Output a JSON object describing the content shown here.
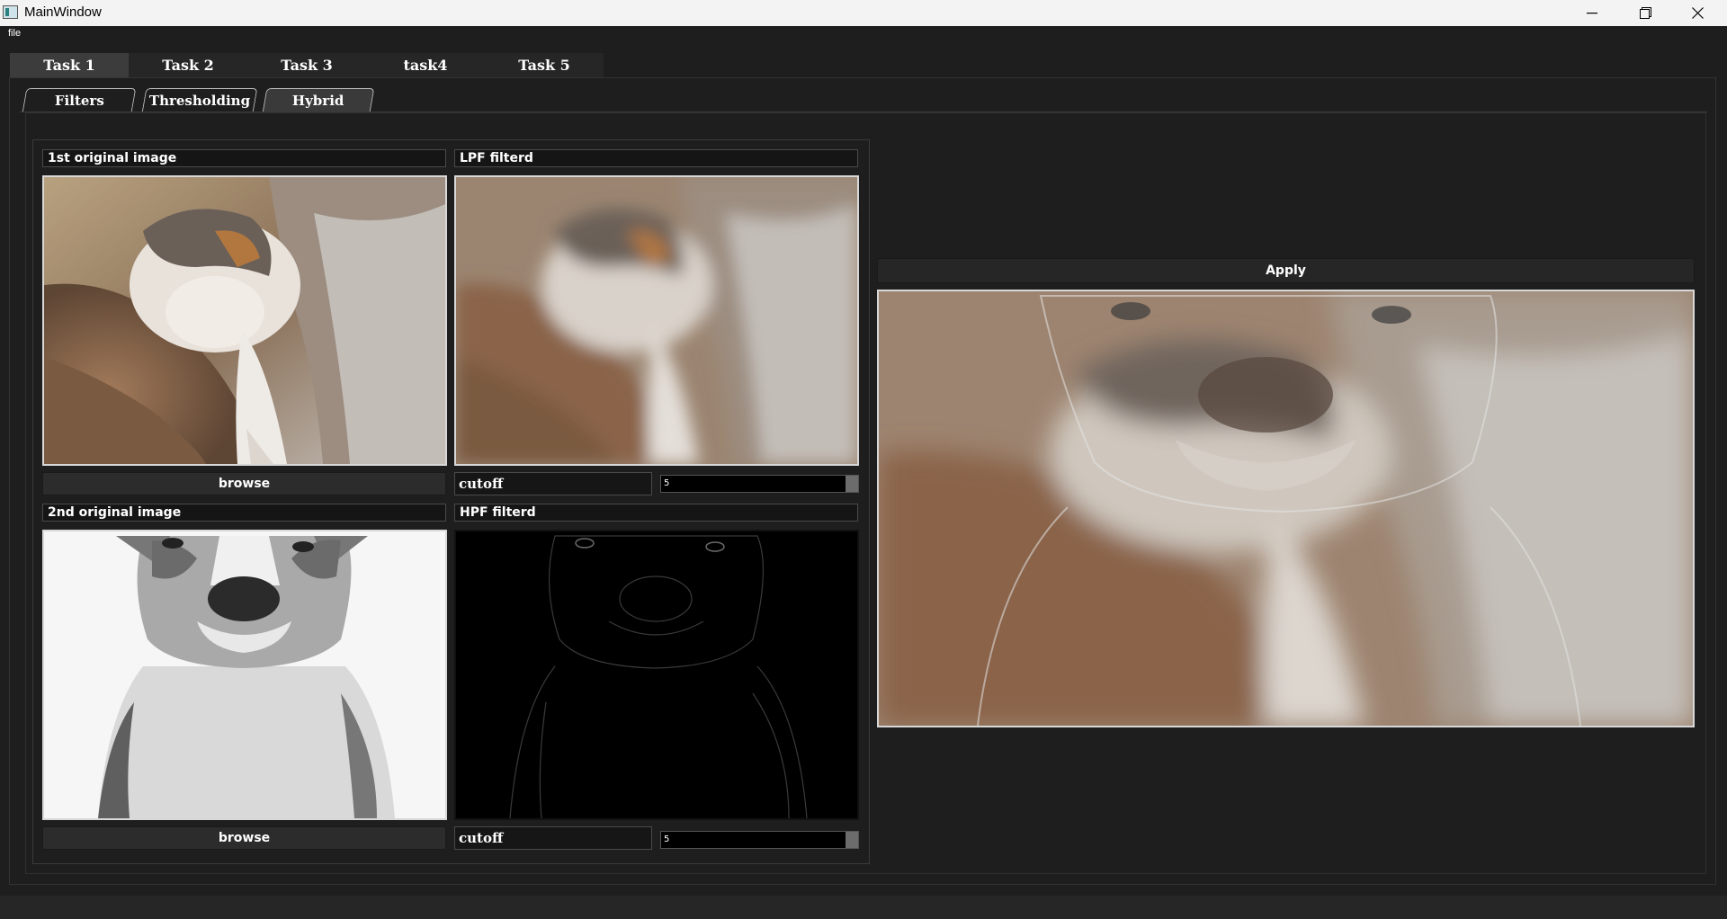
{
  "window": {
    "title": "MainWindow"
  },
  "menu": {
    "file": "file"
  },
  "main_tabs": [
    {
      "label": "Task 1"
    },
    {
      "label": "Task 2"
    },
    {
      "label": "Task 3"
    },
    {
      "label": "task4"
    },
    {
      "label": "Task 5"
    }
  ],
  "sub_tabs": [
    {
      "label": "Filters"
    },
    {
      "label": "Thresholding"
    },
    {
      "label": "Hybrid"
    }
  ],
  "hybrid": {
    "image1_label": "1st original image",
    "lpf_label": "LPF filterd",
    "image2_label": "2nd original image",
    "hpf_label": "HPF filterd",
    "browse1": "browse",
    "browse2": "browse",
    "cutoff1_label": "cutoff",
    "cutoff1_value": "5",
    "cutoff2_label": "cutoff",
    "cutoff2_value": "5",
    "apply": "Apply"
  },
  "icons": {
    "min": "minimize-icon",
    "max": "restore-icon",
    "close": "close-icon"
  }
}
